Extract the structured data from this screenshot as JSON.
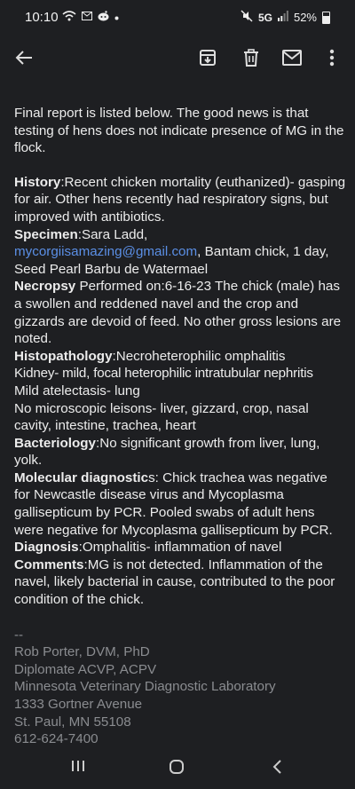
{
  "status_bar": {
    "time": "10:10",
    "network": "5G",
    "battery": "52%"
  },
  "app_bar": {
    "icons": [
      "back-arrow-icon",
      "archive-icon",
      "delete-icon",
      "mail-icon",
      "more-vert-icon"
    ]
  },
  "message": {
    "intro": "Final report is listed below.  The good news is that testing of hens does not indicate presence of MG in the flock.",
    "history_label": "History",
    "history_text": ":Recent chicken mortality (euthanized)- gasping for air.  Other hens recently had respiratory signs, but improved with antibiotics.",
    "specimen_label": "Specimen",
    "specimen_text_1": ":Sara Ladd,",
    "specimen_email": "mycorgiisamazing@gmail.com",
    "specimen_text_2": ", Bantam chick, 1 day, Seed Pearl Barbu de Watermael",
    "necropsy_label": "Necropsy",
    "necropsy_text": " Performed on:6-16-23 The chick (male) has a swollen and reddened navel and the crop and gizzards are devoid of feed.  No other gross lesions are noted.",
    "histopath_label": "Histopathology",
    "histopath_line1": ":Necroheterophilic omphalitis",
    "histopath_line2": "Kidney- mild, focal heterophilic intratubular nephritis",
    "histopath_line3": "Mild atelectasis- lung",
    "histopath_line4": "No microscopic leisons- liver, gizzard, crop, nasal cavity, intestine, trachea, heart",
    "bact_label": "Bacteriology",
    "bact_text": ":No significant growth from liver, lung, yolk.",
    "mol_label": "Molecular diagnostic",
    "mol_text": "s:  Chick trachea was negative for Newcastle disease virus and Mycoplasma gallisepticum by PCR.  Pooled swabs of adult hens were negative for Mycoplasma gallisepticum by PCR.",
    "diag_label": "Diagnosis",
    "diag_text": ":Omphalitis- inflammation of navel",
    "comments_label": "Comments",
    "comments_text": ":MG is not detected.  Inflammation of the navel, likely bacterial in cause, contributed to the poor condition of the chick."
  },
  "signature": {
    "dashes": "--",
    "name": "Rob Porter, DVM, PhD",
    "title": "Diplomate ACVP, ACPV",
    "org": "Minnesota Veterinary Diagnostic Laboratory",
    "street": "1333 Gortner Avenue",
    "city": "St. Paul, MN  55108",
    "phone": "612-624-7400"
  },
  "nav_bar": {
    "icons": [
      "recent-apps-icon",
      "home-icon",
      "back-icon"
    ]
  }
}
